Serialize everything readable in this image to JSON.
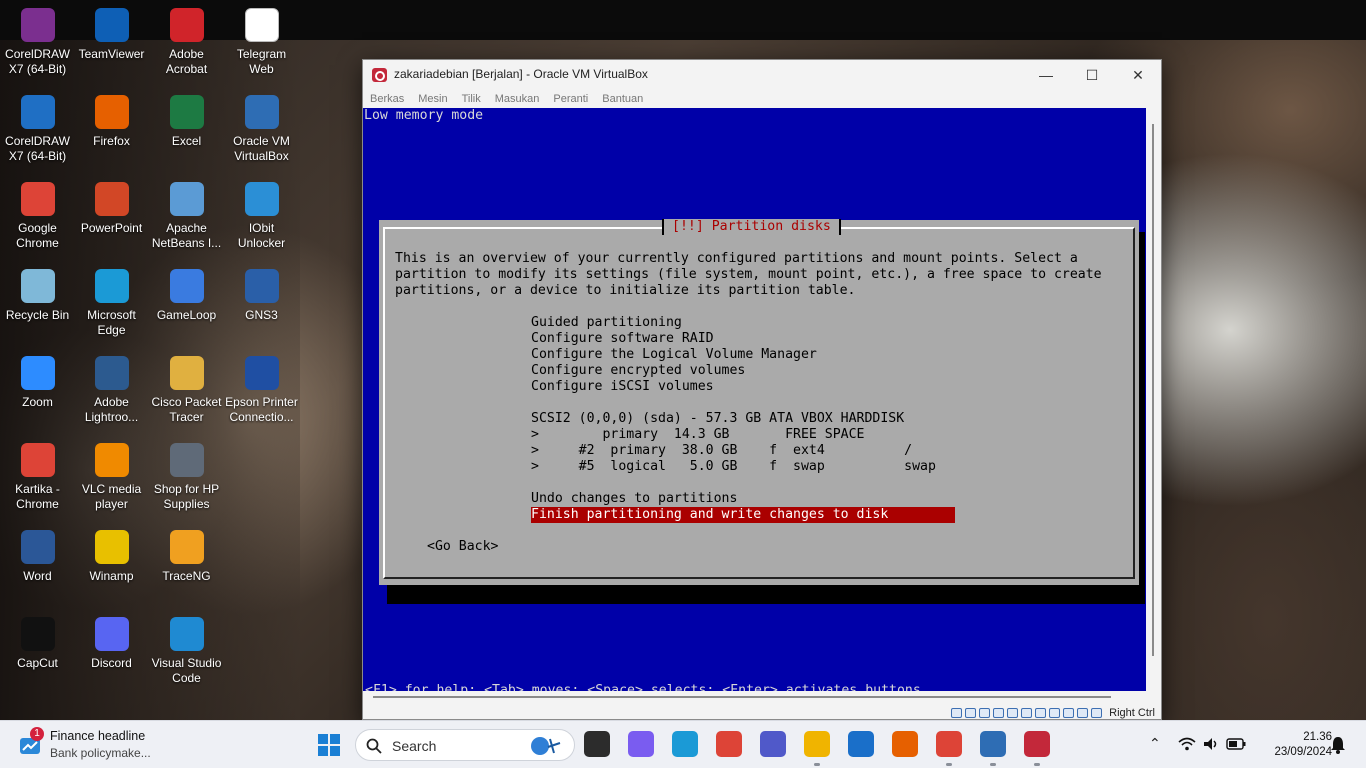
{
  "desktop": {
    "icons": [
      {
        "label": "CorelDRAW X7 (64-Bit)",
        "icon": "winrar-archive-icon",
        "color": "#7b2f8f"
      },
      {
        "label": "TeamViewer",
        "icon": "teamviewer-icon",
        "color": "#0e5fb5"
      },
      {
        "label": "Adobe Acrobat",
        "icon": "adobe-acrobat-icon",
        "color": "#d0242a"
      },
      {
        "label": "Telegram Web",
        "icon": "file-icon",
        "color": "#ffffff"
      },
      {
        "label": "CorelDRAW X7 (64-Bit)",
        "icon": "coreldraw-shortcut-icon",
        "color": "#1f6fc4"
      },
      {
        "label": "Firefox",
        "icon": "firefox-icon",
        "color": "#e66000"
      },
      {
        "label": "Excel",
        "icon": "excel-icon",
        "color": "#1d7a43"
      },
      {
        "label": "Oracle VM VirtualBox",
        "icon": "virtualbox-icon",
        "color": "#2e6db4"
      },
      {
        "label": "Google Chrome",
        "icon": "chrome-icon",
        "color": "#dd4437"
      },
      {
        "label": "PowerPoint",
        "icon": "powerpoint-icon",
        "color": "#d24726"
      },
      {
        "label": "Apache NetBeans I...",
        "icon": "netbeans-icon",
        "color": "#5b9bd5"
      },
      {
        "label": "IObit Unlocker",
        "icon": "unlock-icon",
        "color": "#2b8fd6"
      },
      {
        "label": "Recycle Bin",
        "icon": "recycle-bin-icon",
        "color": "#7fb8d8"
      },
      {
        "label": "Microsoft Edge",
        "icon": "edge-icon",
        "color": "#1b9ad6"
      },
      {
        "label": "GameLoop",
        "icon": "gameloop-icon",
        "color": "#3a7be0"
      },
      {
        "label": "GNS3",
        "icon": "gns3-icon",
        "color": "#2a5fa8"
      },
      {
        "label": "Zoom",
        "icon": "zoom-icon",
        "color": "#2d8cff"
      },
      {
        "label": "Adobe Lightroo...",
        "icon": "lightroom-icon",
        "color": "#2c5a8f"
      },
      {
        "label": "Cisco Packet Tracer",
        "icon": "packet-tracer-icon",
        "color": "#e0b040"
      },
      {
        "label": "Epson Printer Connectio...",
        "icon": "epson-icon",
        "color": "#1f4fa3"
      },
      {
        "label": "Kartika - Chrome",
        "icon": "chrome-profile-icon",
        "color": "#dd4437"
      },
      {
        "label": "VLC media player",
        "icon": "vlc-icon",
        "color": "#f08a00"
      },
      {
        "label": "Shop for HP Supplies",
        "icon": "hp-printer-icon",
        "color": "#5f6a78"
      },
      {
        "label": "Word",
        "icon": "word-icon",
        "color": "#2b5797"
      },
      {
        "label": "Winamp",
        "icon": "winamp-icon",
        "color": "#e8c000"
      },
      {
        "label": "TraceNG",
        "icon": "traceng-icon",
        "color": "#f0a020"
      },
      {
        "label": "CapCut",
        "icon": "capcut-icon",
        "color": "#111111"
      },
      {
        "label": "Discord",
        "icon": "discord-icon",
        "color": "#5865f2"
      },
      {
        "label": "Visual Studio Code",
        "icon": "vscode-icon",
        "color": "#1f8ad2"
      }
    ]
  },
  "vbox": {
    "title": "zakariadebian [Berjalan] - Oracle VM VirtualBox",
    "menu": [
      "Berkas",
      "Mesin",
      "Tilik",
      "Masukan",
      "Peranti",
      "Bantuan"
    ],
    "host_key": "Right Ctrl"
  },
  "installer": {
    "top_message": "Low memory mode",
    "dialog_title": "[!!] Partition disks",
    "intro": [
      "This is an overview of your currently configured partitions and mount points. Select a",
      "partition to modify its settings (file system, mount point, etc.), a free space to create",
      "partitions, or a device to initialize its partition table."
    ],
    "menu_items": [
      "Guided partitioning",
      "Configure software RAID",
      "Configure the Logical Volume Manager",
      "Configure encrypted volumes",
      "Configure iSCSI volumes"
    ],
    "disk": "SCSI2 (0,0,0) (sda) - 57.3 GB ATA VBOX HARDDISK",
    "partitions": [
      ">        primary  14.3 GB       FREE SPACE",
      ">     #2  primary  38.0 GB    f  ext4          /",
      ">     #5  logical   5.0 GB    f  swap          swap"
    ],
    "undo": "Undo changes to partitions",
    "finish": "Finish partitioning and write changes to disk",
    "go_back": "<Go Back>",
    "help_line": "<F1> for help; <Tab> moves; <Space> selects; <Enter> activates buttons"
  },
  "taskbar": {
    "news_title": "Finance headline",
    "news_subtitle": "Bank policymake...",
    "news_badge": "1",
    "search_placeholder": "Search",
    "apps": [
      "task-view-icon",
      "copilot-icon",
      "edge-icon",
      "chrome-icon",
      "teams-icon",
      "file-explorer-icon",
      "store-icon",
      "firefox-icon",
      "chrome-profile-icon",
      "virtualbox-icon",
      "debian-vm-icon"
    ],
    "time": "21.36",
    "date": "23/09/2024"
  }
}
